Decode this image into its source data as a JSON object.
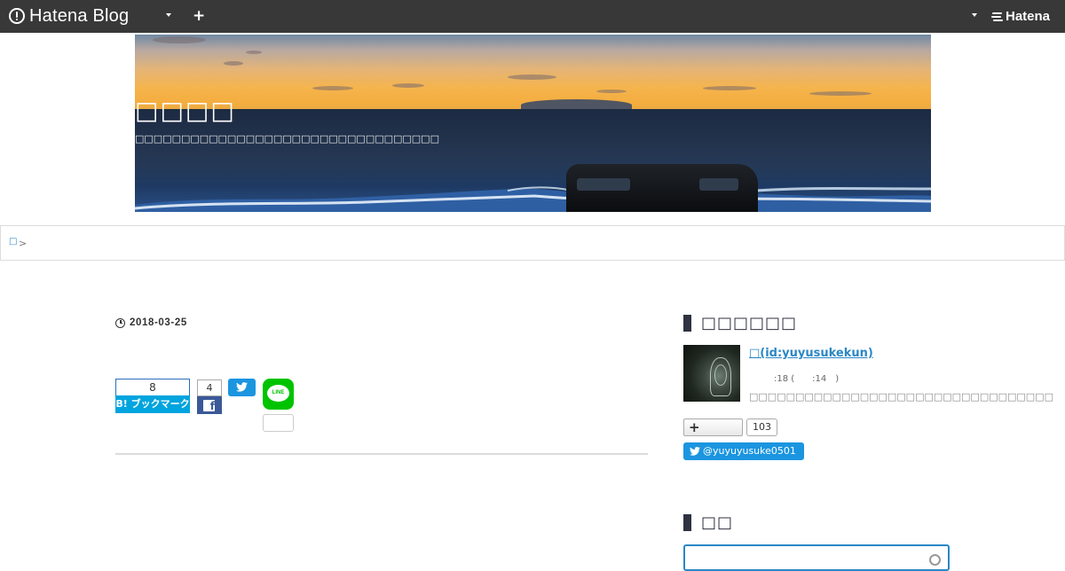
{
  "globalbar": {
    "brand": "Hatena Blog",
    "add_label": "+",
    "hatena_label": "Hatena"
  },
  "blog": {
    "title": "□□□□",
    "description": "□□□□□□□□□□□□□□□□□□□□□□□□□□□□□□□□□"
  },
  "breadcrumb": {
    "home": "□",
    "separator": ">"
  },
  "entry": {
    "date": "2018-03-25"
  },
  "share": {
    "hatena_count": "8",
    "hatena_label": "B! ブックマーク",
    "facebook_count": "4",
    "facebook_label": "f",
    "line_label": "LINE"
  },
  "sidebar": {
    "profile_title": "□□□□□□",
    "profile_name": "□(id:yuyusukekun)",
    "profile_meta": ":18 (　　:14　)",
    "profile_desc": "□□□□□□□□□□□□□□□□□□□□□□□□□□□□□□□□□",
    "follow_label": "+",
    "follow_count": "103",
    "twitter_label": "@yuyuyusuke0501",
    "search_title": "□□",
    "search_placeholder": ""
  },
  "colors": {
    "globalbar": "#383838",
    "link": "#2a87c5",
    "hatena_blue": "#00a4de",
    "facebook": "#3b5998",
    "twitter": "#1b95e0",
    "line": "#00c300"
  }
}
